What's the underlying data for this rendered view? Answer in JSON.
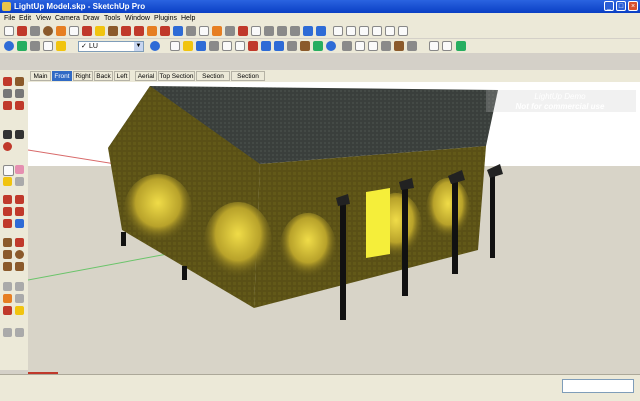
{
  "window": {
    "title": "LightUp Model.skp - SketchUp Pro",
    "min": "_",
    "max": "□",
    "close": "×"
  },
  "menu": [
    "File",
    "Edit",
    "View",
    "Camera",
    "Draw",
    "Tools",
    "Window",
    "Plugins",
    "Help"
  ],
  "layer": {
    "name": "LU",
    "check": "✓",
    "arrow": "▼"
  },
  "scenes": [
    {
      "label": "Main",
      "active": false
    },
    {
      "label": "Front",
      "active": true
    },
    {
      "label": "Right",
      "active": false
    },
    {
      "label": "Back",
      "active": false
    },
    {
      "label": "Left",
      "active": false
    },
    {
      "label": "Aerial",
      "active": false
    },
    {
      "label": "Top Section",
      "active": false
    },
    {
      "label": "Section NS",
      "active": false
    },
    {
      "label": "Section EW",
      "active": false
    }
  ],
  "watermark": {
    "line1": "LightUp Demo",
    "line2": "Not for commercial use"
  },
  "colors": {
    "sky": "#ffffff",
    "ground": "#d8d4c8",
    "roof": "#3a3f3c",
    "wall": "#5a5016",
    "glow": "#e8d23a",
    "door": "#f5ee3a"
  },
  "icons": [
    "select-icon",
    "pencil-icon",
    "rectangle-icon",
    "circle-icon",
    "arc-icon",
    "eraser-icon",
    "paint-icon",
    "push-pull-icon",
    "move-icon",
    "rotate-icon",
    "scale-icon",
    "offset-icon",
    "tape-icon",
    "orbit-icon",
    "pan-icon",
    "zoom-icon",
    "zoom-extents-icon",
    "component-icon",
    "walk-icon",
    "look-around-icon",
    "section-icon"
  ]
}
